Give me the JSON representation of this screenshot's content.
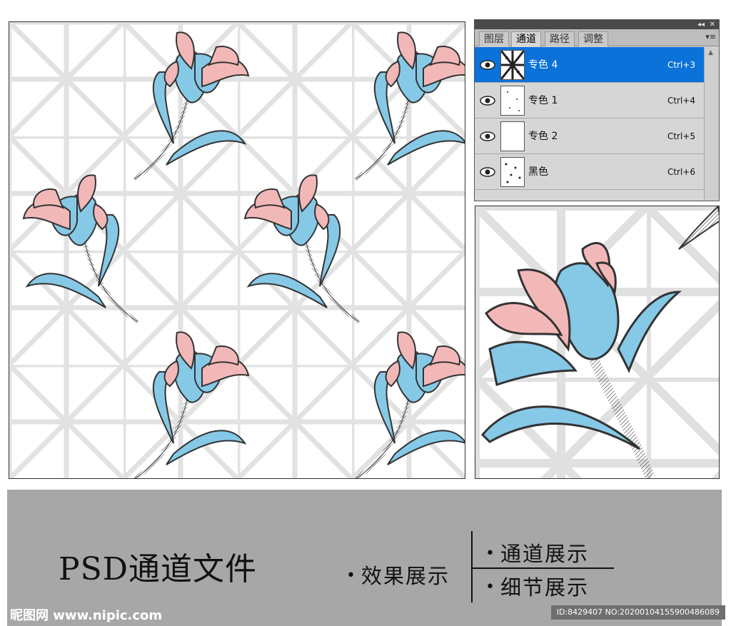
{
  "channels_panel": {
    "tabs": [
      "图层",
      "通道",
      "路径",
      "调整"
    ],
    "active_tab": 1,
    "menu_icon": "panel-menu-icon",
    "rows": [
      {
        "name": "专色 4",
        "shortcut": "Ctrl+3",
        "selected": true
      },
      {
        "name": "专色 1",
        "shortcut": "Ctrl+4",
        "selected": false
      },
      {
        "name": "专色 2",
        "shortcut": "Ctrl+5",
        "selected": false
      },
      {
        "name": "黑色",
        "shortcut": "Ctrl+6",
        "selected": false
      }
    ]
  },
  "banner": {
    "title": "PSD通道文件",
    "effect_label": "效果展示",
    "channel_label": "通道展示",
    "detail_label": "细节展示"
  },
  "watermark": {
    "logo": "昵图网 www.nipic.com",
    "id_text": "ID:8429407 NO:20200104155900486089"
  },
  "colors": {
    "flower_pink": "#f2b8b8",
    "flower_blue": "#86c9e6",
    "outline": "#333333",
    "lattice": "#e2e2e2",
    "banner_bg": "#a7a7a7",
    "selected_row": "#0a72d8"
  }
}
